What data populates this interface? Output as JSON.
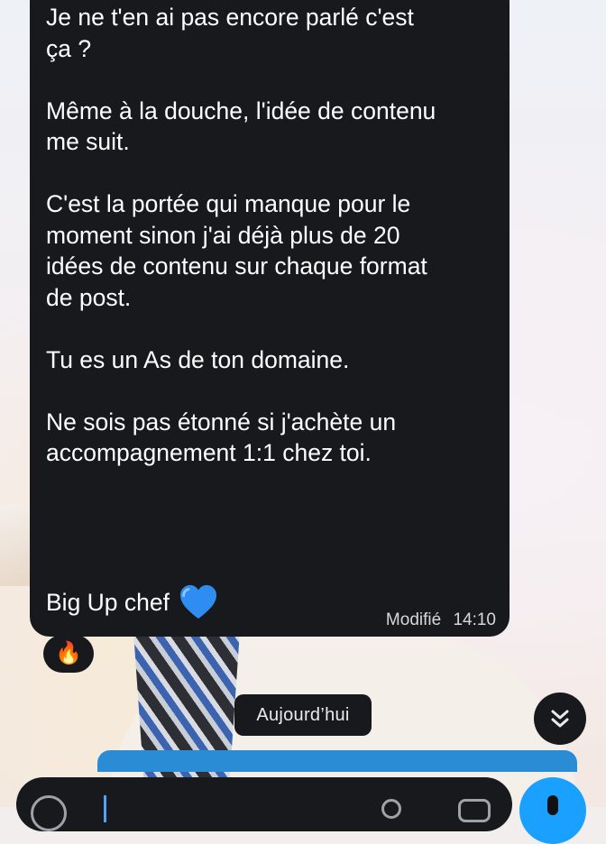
{
  "message": {
    "text": "Je ne t'en ai pas encore parlé c'est\nça ?\n\nMême à la douche, l'idée de contenu\nme suit.\n\nC'est la portée qui manque pour le\nmoment sinon j'ai déjà plus de 20\nidées de contenu sur chaque format\nde post.\n\nTu es un As de ton domaine.\n\nNe sois pas étonné si j'achète un\naccompagnement 1:1 chez toi.",
    "signoff": "Big Up chef",
    "signoff_emoji": "blue-heart-icon",
    "edited_label": "Modifié",
    "time": "14:10",
    "reaction": "🔥"
  },
  "date_separator": "Aujourd’hui",
  "scroll_button_icon": "double-chevron-down-icon",
  "composer": {
    "emoji_icon": "emoji-icon",
    "attach_icon": "attach-icon",
    "camera_icon": "camera-icon",
    "mic_icon": "mic-icon"
  },
  "colors": {
    "bubble_bg": "#17191c",
    "accent": "#1aa0ff",
    "heart": "#2f8cf0"
  }
}
